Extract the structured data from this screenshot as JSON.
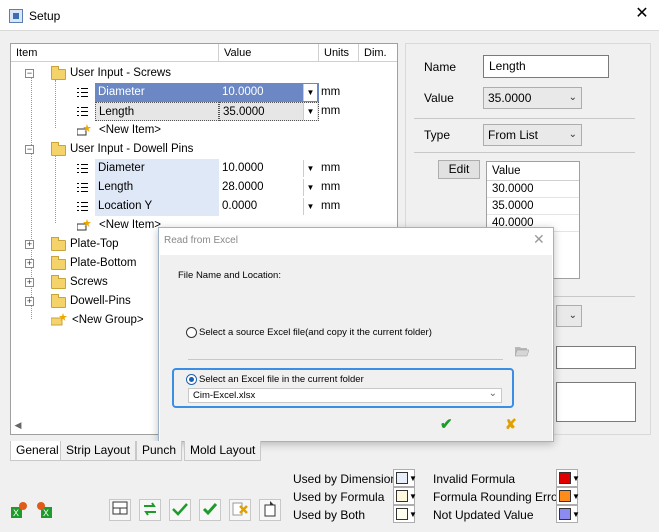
{
  "window": {
    "title": "Setup",
    "close_glyph": "✕"
  },
  "tree": {
    "columns": [
      "Item",
      "Value",
      "Units",
      "Dim."
    ],
    "rows": [
      {
        "text": "User Input - Screws",
        "expander": "−"
      },
      {
        "text": "Diameter",
        "value": "10.0000",
        "units": "mm"
      },
      {
        "text": "Length",
        "value": "35.0000",
        "units": "mm"
      },
      {
        "text": "<New Item>"
      },
      {
        "text": "User Input - Dowell Pins",
        "expander": "−"
      },
      {
        "text": "Diameter",
        "value": "10.0000",
        "units": "mm"
      },
      {
        "text": "Length",
        "value": "28.0000",
        "units": "mm"
      },
      {
        "text": "Location Y",
        "value": "0.0000",
        "units": "mm"
      },
      {
        "text": "<New Item>"
      },
      {
        "text": "Plate-Top",
        "expander": "+"
      },
      {
        "text": "Plate-Bottom",
        "expander": "+"
      },
      {
        "text": "Screws",
        "expander": "+"
      },
      {
        "text": "Dowell-Pins",
        "expander": "+"
      },
      {
        "text": "<New Group>"
      }
    ],
    "dropdown_glyph": "▼",
    "scroll_left_glyph": "◀"
  },
  "panel": {
    "name_label": "Name",
    "name_value": "Length",
    "value_label": "Value",
    "value_value": "35.0000",
    "type_label": "Type",
    "type_value": "From List",
    "edit_button": "Edit",
    "list_header": "Value",
    "list_values": [
      "30.0000",
      "35.0000",
      "40.0000"
    ],
    "chevron": "⌄"
  },
  "dialog": {
    "title": "Read from Excel",
    "close_glyph": "✕",
    "section_label": "File Name and Location:",
    "option1": "Select a source Excel file(and copy it the current folder)",
    "option2": "Select an Excel file in the current folder",
    "file_value": "Cim-Excel.xlsx",
    "ok_glyph": "✔",
    "cancel_glyph": "✘"
  },
  "tabs": [
    "General",
    "Strip Layout",
    "Punch",
    "Mold Layout"
  ],
  "legend": {
    "used_by_dimension": "Used by Dimension",
    "used_by_formula": "Used by Formula",
    "used_by_both": "Used by Both",
    "invalid_formula": "Invalid Formula",
    "formula_rounding_error": "Formula Rounding Error",
    "not_updated_value": "Not Updated Value",
    "colors": {
      "dimension": "#e8eefa",
      "formula": "#fff8dc",
      "both": "#fffff0",
      "invalid": "#e00000",
      "rounding": "#ff8c1a",
      "not_updated": "#8c8cf0"
    }
  },
  "colors": {
    "selection": "#6b88c4",
    "input_highlight": "#dfe8f7",
    "accent_border": "#3a8ee6",
    "ok_green": "#1e9b2a"
  }
}
